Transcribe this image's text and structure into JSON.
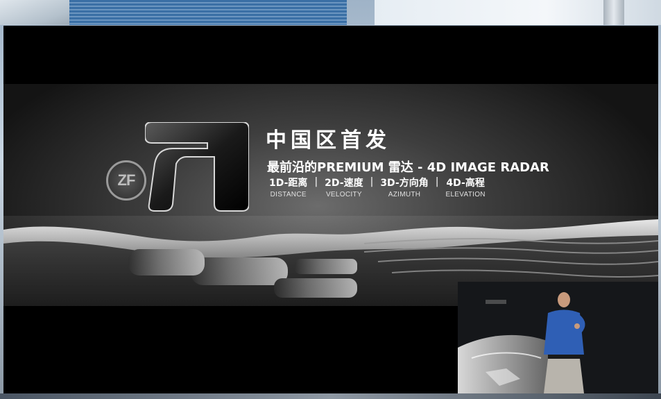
{
  "slide": {
    "logo_text": "ZF",
    "title": "中国区首发",
    "subtitle": "最前沿的PREMIUM 雷达 - 4D IMAGE RADAR",
    "dimensions": [
      {
        "label": "1D-距离",
        "sub": "DISTANCE"
      },
      {
        "label": "2D-速度",
        "sub": "VELOCITY"
      },
      {
        "label": "3D-方向角",
        "sub": "AZIMUTH"
      },
      {
        "label": "4D-高程",
        "sub": "ELEVATION"
      }
    ],
    "separator": "|"
  },
  "pip": {
    "label": "speaker camera"
  }
}
